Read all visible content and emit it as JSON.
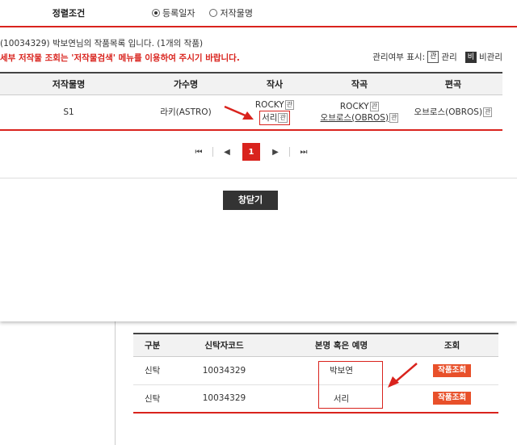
{
  "sort": {
    "label": "정렬조건",
    "options": [
      {
        "label": "등록일자",
        "selected": true
      },
      {
        "label": "저작물명",
        "selected": false
      }
    ]
  },
  "info": {
    "line1": "(10034329) 박보연님의 작품목록 입니다. (1개의 작품)",
    "line2": "세부 저작물 조회는 '저작물검색' 메뉴를 이용하여 주시기 바랍니다."
  },
  "legend": {
    "prefix": "관리여부 표시:",
    "managed_badge": "관",
    "managed_label": "관리",
    "unmanaged_badge": "비",
    "unmanaged_label": "비관리"
  },
  "works": {
    "headers": [
      "저작물명",
      "가수명",
      "작사",
      "작곡",
      "편곡"
    ],
    "row": {
      "title": "S1",
      "singer": "라키(ASTRO)",
      "lyricist1": "ROCKY",
      "lyricist2": "서리",
      "composer1": "ROCKY",
      "composer2": "오브로스(OBROS)",
      "arranger": "오브로스(OBROS)",
      "badge": "관"
    }
  },
  "pager": {
    "first": "⏮",
    "prev": "◀",
    "current": "1",
    "next": "▶",
    "last": "⏭"
  },
  "close_button": "창닫기",
  "trustee": {
    "headers": [
      "구분",
      "신탁자코드",
      "본명 혹은 예명",
      "조회"
    ],
    "rows": [
      {
        "type": "신탁",
        "code": "10034329",
        "name": "박보연",
        "action": "작품조회"
      },
      {
        "type": "신탁",
        "code": "10034329",
        "name": "서리",
        "action": "작품조회"
      }
    ]
  },
  "colors": {
    "accent_red": "#d9231d",
    "button_orange": "#e8502a",
    "button_dark": "#333333"
  }
}
